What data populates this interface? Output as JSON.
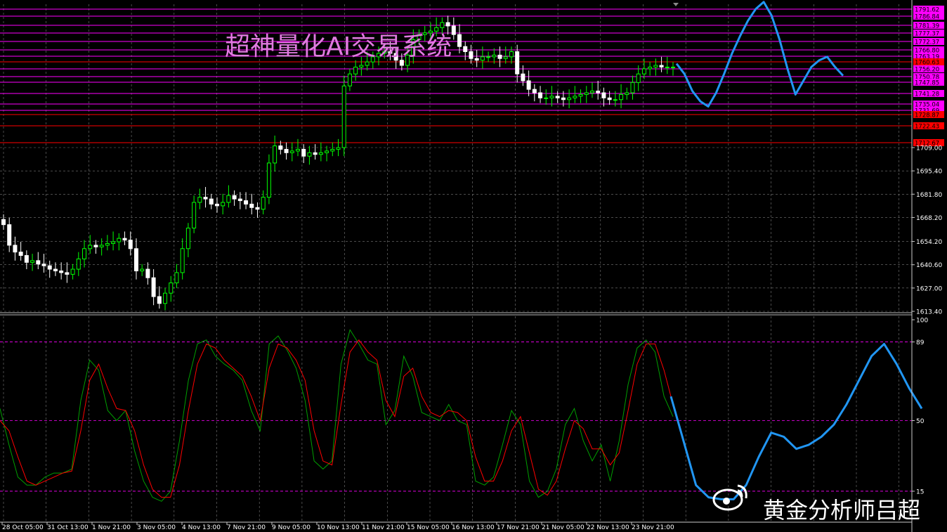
{
  "title_overlay": "超神量化AI交易系统",
  "watermark": "黄金分析师吕超",
  "colors": {
    "background": "#000000",
    "grid": "#7a7a7a",
    "candle_up": "#00ff00",
    "candle_down": "#ffffff",
    "stoch_main": "#00a000",
    "stoch_signal": "#ff0000",
    "forecast": "#2196f3",
    "magenta_level": "#ff00ff",
    "red_level": "#ff0000",
    "title_color": "#e07ae0"
  },
  "chart_data": [
    {
      "type": "candlestick",
      "symbol_panel": "price",
      "ylim": [
        1613.4,
        1795
      ],
      "y_ticks": [
        "1709.00",
        "1695.40",
        "1681.80",
        "1668.20",
        "1654.20",
        "1640.60",
        "1627.00",
        "1613.40"
      ],
      "x_ticks": [
        "28 Oct 05:00",
        "31 Oct 13:00",
        "1 Nov 21:00",
        "3 Nov 05:00",
        "4 Nov 13:00",
        "7 Nov 21:00",
        "9 Nov 05:00",
        "10 Nov 13:00",
        "11 Nov 21:00",
        "15 Nov 05:00",
        "16 Nov 13:00",
        "17 Nov 21:00",
        "21 Nov 05:00",
        "22 Nov 13:00",
        "23 Nov 21:00"
      ],
      "closes": [
        1664,
        1652,
        1648,
        1646,
        1642,
        1643,
        1641,
        1640,
        1638,
        1637,
        1636,
        1635,
        1638,
        1644,
        1650,
        1652,
        1651,
        1652,
        1653,
        1654,
        1656,
        1655,
        1650,
        1637,
        1638,
        1633,
        1622,
        1618,
        1624,
        1630,
        1636,
        1650,
        1662,
        1677,
        1680,
        1679,
        1676,
        1675,
        1677,
        1681,
        1679,
        1678,
        1676,
        1674,
        1673,
        1680,
        1700,
        1710,
        1708,
        1706,
        1707,
        1708,
        1704,
        1706,
        1705,
        1706,
        1707,
        1708,
        1709,
        1745,
        1752,
        1756,
        1757,
        1759,
        1762,
        1764,
        1765,
        1764,
        1760,
        1757,
        1763,
        1772,
        1775,
        1776,
        1777,
        1779,
        1782,
        1780,
        1775,
        1768,
        1765,
        1761,
        1760,
        1762,
        1762,
        1763,
        1761,
        1762,
        1765,
        1752,
        1748,
        1743,
        1741,
        1738,
        1738,
        1739,
        1738,
        1737,
        1738,
        1739,
        1740,
        1741,
        1742,
        1741,
        1738,
        1737,
        1737,
        1740,
        1741,
        1747,
        1752,
        1755,
        1756,
        1757,
        1756,
        1756,
        1756
      ],
      "annotation_levels_magenta": [
        "1791.62",
        "1786.84",
        "1781.39",
        "1777.37",
        "1772.37",
        "1766.80",
        "1763.19",
        "1756.20",
        "1750.78",
        "1747.85",
        "1741.28",
        "1735.04",
        "1731.69"
      ],
      "annotation_levels_red": [
        "1760.63",
        "1728.87",
        "1722.43",
        "1712.67"
      ],
      "forecast_path": [
        1758,
        1752,
        1742,
        1736,
        1733,
        1741,
        1752,
        1764,
        1774,
        1783,
        1790,
        1794,
        1786,
        1772,
        1755,
        1740,
        1748,
        1756,
        1760,
        1762,
        1756,
        1751
      ]
    },
    {
      "type": "line",
      "symbol_panel": "stochastic",
      "ylim": [
        0,
        100
      ],
      "levels": [
        "89",
        "50",
        "15"
      ],
      "y_ticks": [
        "100",
        "89",
        "50",
        "15"
      ],
      "series": [
        {
          "name": "",
          "values": [
            56,
            38,
            22,
            18,
            18,
            22,
            24,
            24,
            26,
            60,
            80,
            75,
            55,
            50,
            55,
            35,
            20,
            12,
            10,
            15,
            40,
            70,
            88,
            90,
            82,
            78,
            75,
            70,
            55,
            45,
            88,
            92,
            85,
            76,
            60,
            30,
            26,
            30,
            78,
            95,
            88,
            80,
            78,
            48,
            55,
            82,
            72,
            54,
            52,
            50,
            58,
            50,
            48,
            20,
            18,
            22,
            38,
            55,
            48,
            20,
            12,
            15,
            26,
            48,
            56,
            40,
            30,
            38,
            20,
            40,
            68,
            86,
            90,
            84,
            62,
            52
          ]
        },
        {
          "name": "",
          "values": [
            50,
            45,
            32,
            20,
            18,
            20,
            22,
            24,
            25,
            45,
            70,
            78,
            66,
            56,
            55,
            45,
            28,
            16,
            12,
            12,
            28,
            55,
            78,
            88,
            86,
            80,
            76,
            72,
            62,
            50,
            76,
            88,
            86,
            80,
            70,
            45,
            30,
            28,
            58,
            84,
            90,
            84,
            80,
            60,
            52,
            72,
            76,
            62,
            54,
            52,
            55,
            54,
            50,
            32,
            20,
            20,
            30,
            45,
            52,
            34,
            16,
            13,
            20,
            36,
            50,
            46,
            36,
            36,
            28,
            34,
            55,
            78,
            88,
            88,
            75,
            58
          ]
        }
      ],
      "forecast_path": [
        62,
        40,
        18,
        12,
        11,
        11,
        18,
        32,
        44,
        42,
        36,
        38,
        42,
        48,
        58,
        70,
        82,
        88,
        78,
        66,
        56
      ]
    }
  ]
}
